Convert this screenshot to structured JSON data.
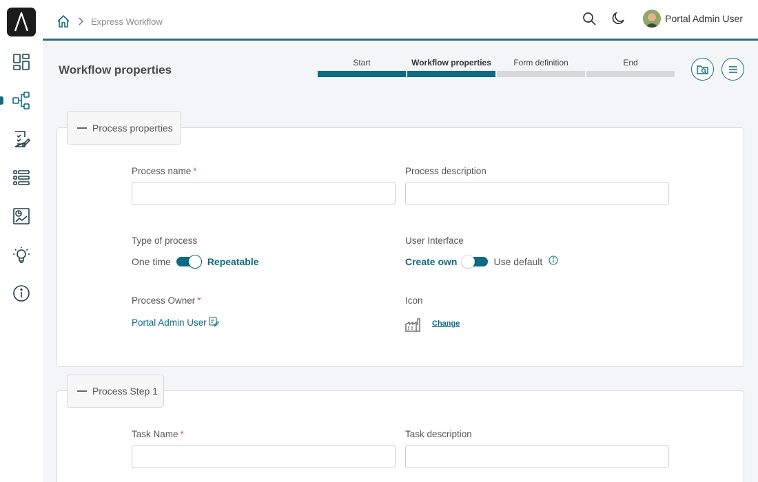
{
  "breadcrumb": {
    "current": "Express Workflow"
  },
  "header": {
    "user_name": "Portal Admin User"
  },
  "page": {
    "title": "Workflow properties"
  },
  "stepper": {
    "steps": [
      {
        "label": "Start",
        "done": true
      },
      {
        "label": "Workflow properties",
        "done": true
      },
      {
        "label": "Form definition",
        "done": false
      },
      {
        "label": "End",
        "done": false
      }
    ]
  },
  "process_properties": {
    "tab_label": "Process properties",
    "process_name_label": "Process name",
    "process_name_value": "",
    "process_description_label": "Process description",
    "process_description_value": "",
    "type_label": "Type of process",
    "type_option_left": "One time",
    "type_option_right": "Repeatable",
    "ui_label": "User Interface",
    "ui_option_left": "Create own",
    "ui_option_right": "Use default",
    "owner_label": "Process Owner",
    "owner_value": "Portal Admin User",
    "icon_label": "Icon",
    "icon_change_label": "Change"
  },
  "process_step": {
    "tab_label": "Process Step 1",
    "task_name_label": "Task Name",
    "task_name_value": "",
    "task_description_label": "Task description",
    "task_description_value": ""
  },
  "colors": {
    "accent": "#0d6a84",
    "required": "#e05050"
  }
}
